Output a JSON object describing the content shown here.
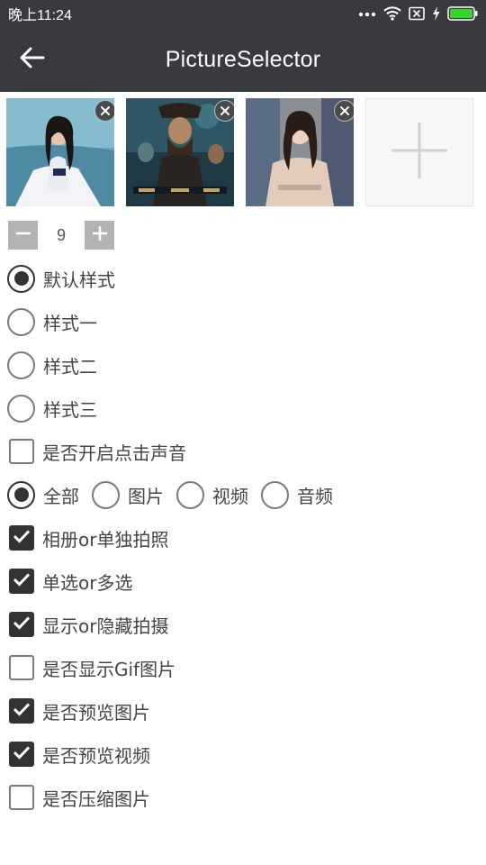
{
  "status_bar": {
    "time": "晚上11:24",
    "icons": [
      "more-dots-icon",
      "wifi-icon",
      "no-sim-icon",
      "charging-icon",
      "battery-icon"
    ],
    "battery_color": "#38d32e"
  },
  "app_bar": {
    "title": "PictureSelector",
    "back_icon": "arrow-left-icon",
    "background": "#393a3e"
  },
  "selected_images": [
    {
      "name": "girl-by-the-sea",
      "remove_icon": "close-circle-icon"
    },
    {
      "name": "pirates-movie-poster",
      "remove_icon": "close-circle-icon"
    },
    {
      "name": "woman-at-event",
      "remove_icon": "close-circle-icon"
    }
  ],
  "add_tile": {
    "icon": "plus-icon"
  },
  "max_count": {
    "value": "9",
    "minus_icon": "minus-icon",
    "plus_icon": "plus-icon"
  },
  "styles": [
    {
      "label": "默认样式",
      "checked": true
    },
    {
      "label": "样式一",
      "checked": false
    },
    {
      "label": "样式二",
      "checked": false
    },
    {
      "label": "样式三",
      "checked": false
    }
  ],
  "sound_option": {
    "label": "是否开启点击声音",
    "checked": false
  },
  "media_types": [
    {
      "label": "全部",
      "checked": true
    },
    {
      "label": "图片",
      "checked": false
    },
    {
      "label": "视频",
      "checked": false
    },
    {
      "label": "音频",
      "checked": false
    }
  ],
  "options": [
    {
      "label": "相册or单独拍照",
      "checked": true
    },
    {
      "label": "单选or多选",
      "checked": true
    },
    {
      "label": "显示or隐藏拍摄",
      "checked": true
    },
    {
      "label": "是否显示Gif图片",
      "checked": false
    },
    {
      "label": "是否预览图片",
      "checked": true
    },
    {
      "label": "是否预览视频",
      "checked": true
    },
    {
      "label": "是否压缩图片",
      "checked": false
    }
  ]
}
